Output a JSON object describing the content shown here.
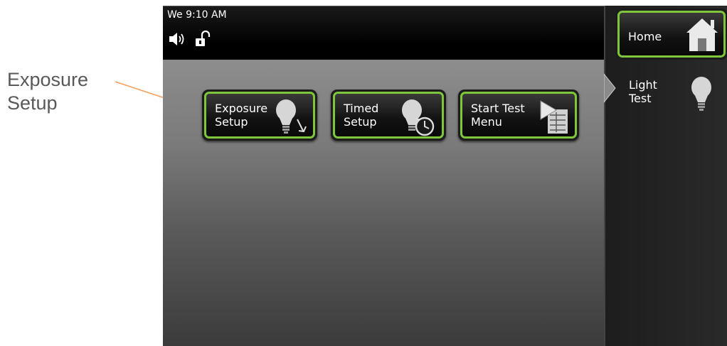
{
  "callout": {
    "text": "Exposure\nSetup"
  },
  "status_bar": {
    "clock": "We 9:10 AM",
    "icons": [
      "speaker-icon",
      "unlock-icon"
    ]
  },
  "tiles": [
    {
      "label": "Exposure\nSetup",
      "icon": "lightbulb-arrow-icon"
    },
    {
      "label": "Timed\nSetup",
      "icon": "lightbulb-timer-icon"
    },
    {
      "label": "Start Test\nMenu",
      "icon": "play-list-icon"
    }
  ],
  "sidebar": {
    "home_label": "Home",
    "home_icon": "house-icon",
    "active_item": {
      "label": "Light\nTest",
      "icon": "lightbulb-icon"
    }
  },
  "colors": {
    "accent": "#7ec73a",
    "callout_arrow": "#f4a15f"
  }
}
